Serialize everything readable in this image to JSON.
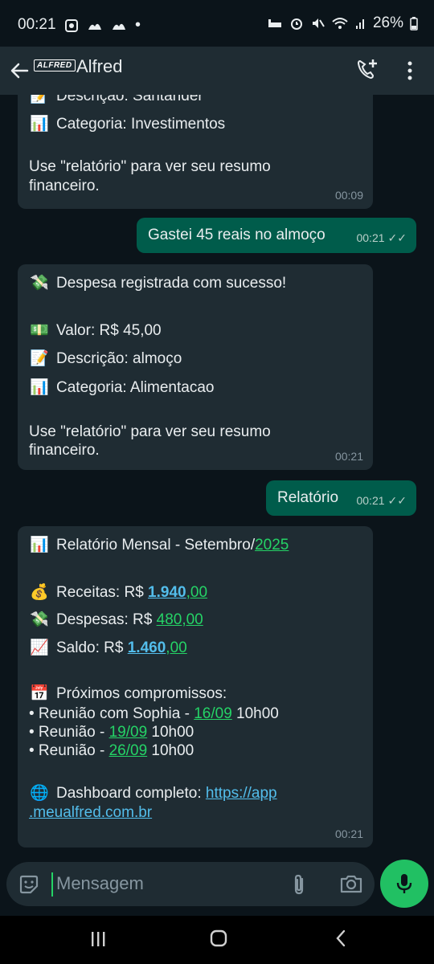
{
  "status_bar": {
    "time": "00:21",
    "battery": "26%",
    "left_icons": [
      "whatsapp-icon",
      "notification-icon",
      "notification-icon"
    ],
    "right_icons": [
      "sleep-icon",
      "alarm-icon",
      "mute-icon",
      "wifi-icon",
      "signal-icon",
      "battery-icon"
    ]
  },
  "header": {
    "logo_text": "ALFRED",
    "title": "Alfred"
  },
  "messages": [
    {
      "direction": "in",
      "lines": [
        "📝 Descrição: Santander",
        "📊 Categoria: Investimentos",
        "",
        "Use \"relatório\" para ver seu resumo",
        "financeiro."
      ],
      "line1": "Descrição: Santander",
      "line2": "Categoria: Investimentos",
      "line3": "Use \"relatório\" para ver seu resumo",
      "line4": "financeiro.",
      "time": "00:09"
    },
    {
      "direction": "out",
      "text": "Gastei 45 reais no almoço",
      "time": "00:21"
    },
    {
      "direction": "in",
      "line1": "Despesa registrada com sucesso!",
      "line2": "Valor: R$ 45,00",
      "line3": "Descrição: almoço",
      "line4": "Categoria: Alimentacao",
      "line5": "Use \"relatório\" para ver seu resumo",
      "line6": "financeiro.",
      "time": "00:21"
    },
    {
      "direction": "out",
      "text": "Relatório",
      "time": "00:21"
    },
    {
      "direction": "in",
      "title": "Relatório Mensal - Setembro/",
      "year": "2025",
      "receitas_label": "Receitas: R$ ",
      "receitas_int": "1.940",
      "receitas_sep": ",",
      "receitas_dec": "00",
      "despesas_label": "Despesas: R$ ",
      "despesas_int": "480",
      "despesas_sep": ",",
      "despesas_dec": "00",
      "saldo_label": "Saldo: R$ ",
      "saldo_int": "1.460",
      "saldo_sep": ",",
      "saldo_dec": "00",
      "compromissos_label": "Próximos compromissos:",
      "c1_prefix": "• Reunião com Sophia - ",
      "c1_date": "16/09",
      "c1_time": " 10h00",
      "c2_prefix": "• Reunião - ",
      "c2_date": "19/09",
      "c2_time": " 10h00",
      "c3_prefix": "• Reunião - ",
      "c3_date": "26/09",
      "c3_time": " 10h00",
      "dashboard_label": "Dashboard completo: ",
      "dashboard_link_1": "https://app",
      "dashboard_link_2": ".meualfred.com.br",
      "time": "00:21"
    }
  ],
  "composer": {
    "placeholder": "Mensagem"
  },
  "colors": {
    "background": "#0b141a",
    "incoming_bubble": "#1f2c33",
    "outgoing_bubble": "#005c4b",
    "accent_green": "#25d366",
    "link_blue": "#53bdeb"
  }
}
